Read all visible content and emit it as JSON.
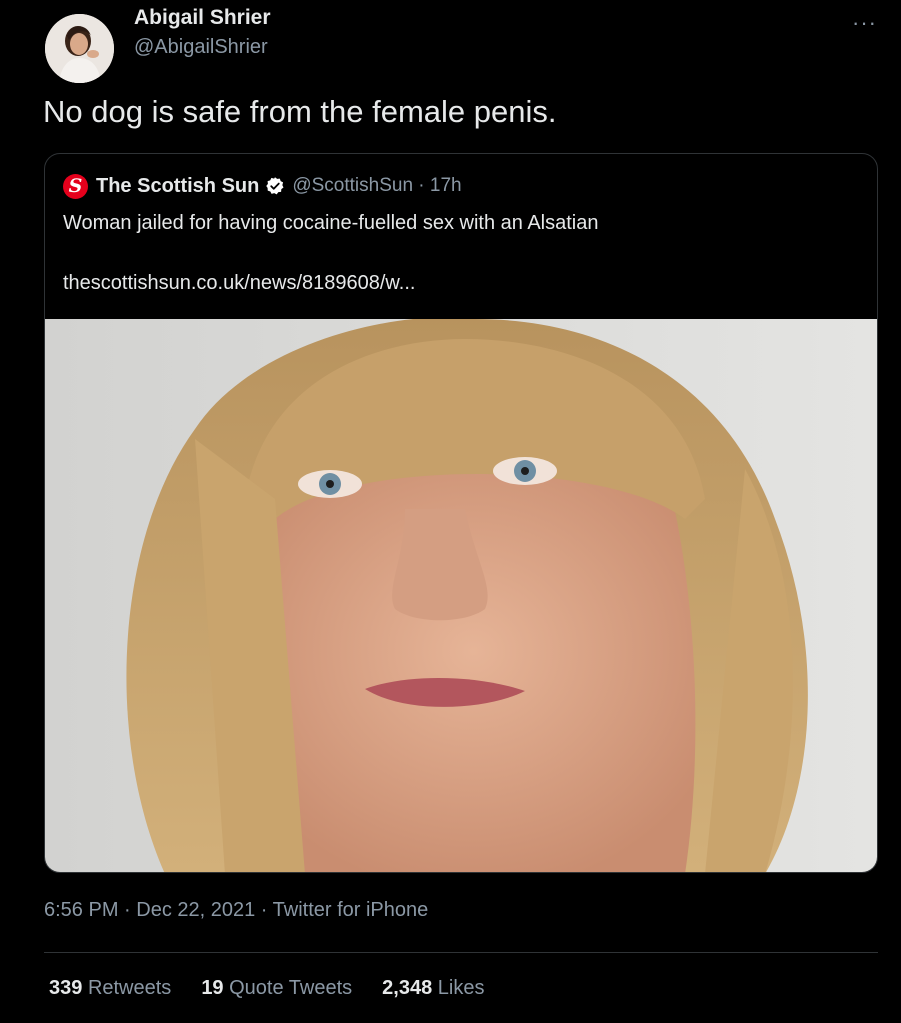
{
  "author": {
    "name": "Abigail Shrier",
    "handle": "@AbigailShrier"
  },
  "more_label": "···",
  "tweet": {
    "text": "No dog is safe from the female penis."
  },
  "quote": {
    "logo_letter": "S",
    "name": "The Scottish Sun",
    "handle_time": "@ScottishSun · 17h",
    "text": "Woman jailed for having cocaine-fuelled sex with an Alsatian",
    "link": "thescottishsun.co.uk/news/8189608/w..."
  },
  "meta": "6:56 PM · Dec 22, 2021 · Twitter for iPhone",
  "stats": {
    "retweets_count": "339",
    "retweets_label": "Retweets",
    "quotes_count": "19",
    "quotes_label": "Quote Tweets",
    "likes_count": "2,348",
    "likes_label": "Likes"
  },
  "colors": {
    "background": "#000000",
    "text": "#e7e9ea",
    "secondary": "#8b98a5",
    "border": "#2f3336",
    "sun_red": "#e5001c",
    "verified": "#ffffff"
  }
}
